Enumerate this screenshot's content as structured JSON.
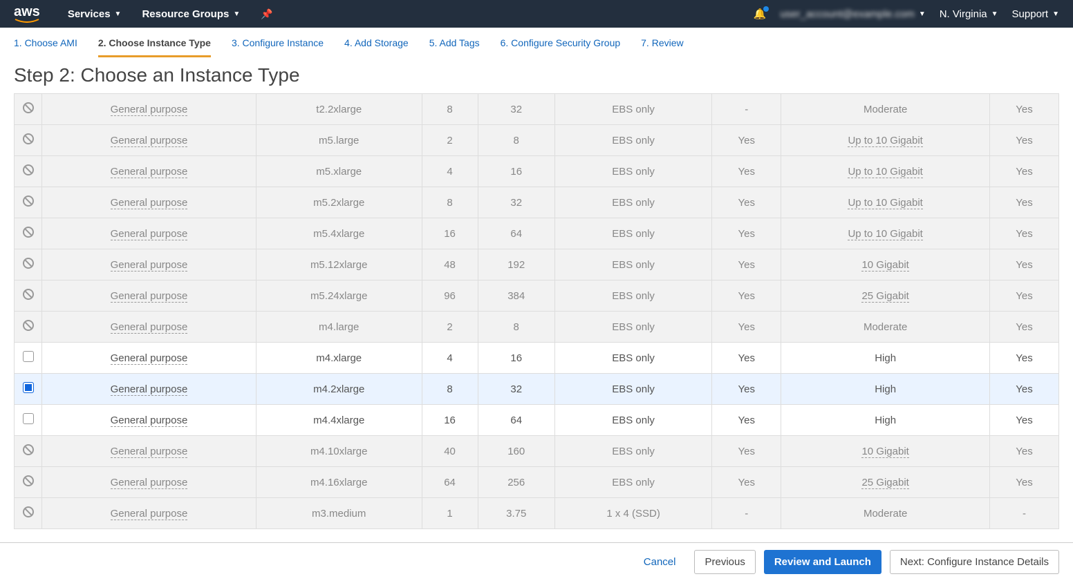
{
  "topnav": {
    "logo": "aws",
    "services": "Services",
    "resource_groups": "Resource Groups",
    "account_blur": "user_account@example.com",
    "region": "N. Virginia",
    "support": "Support"
  },
  "steps": {
    "s1": "1. Choose AMI",
    "s2": "2. Choose Instance Type",
    "s3": "3. Configure Instance",
    "s4": "4. Add Storage",
    "s5": "5. Add Tags",
    "s6": "6. Configure Security Group",
    "s7": "7. Review"
  },
  "page_title": "Step 2: Choose an Instance Type",
  "rows": [
    {
      "sel": "ban",
      "family": "General purpose",
      "type": "t2.2xlarge",
      "vcpu": "8",
      "mem": "32",
      "storage": "EBS only",
      "ebs": "-",
      "net": "Moderate",
      "ipv6": "Yes",
      "net_dash": false
    },
    {
      "sel": "ban",
      "family": "General purpose",
      "type": "m5.large",
      "vcpu": "2",
      "mem": "8",
      "storage": "EBS only",
      "ebs": "Yes",
      "net": "Up to 10 Gigabit",
      "ipv6": "Yes",
      "net_dash": true
    },
    {
      "sel": "ban",
      "family": "General purpose",
      "type": "m5.xlarge",
      "vcpu": "4",
      "mem": "16",
      "storage": "EBS only",
      "ebs": "Yes",
      "net": "Up to 10 Gigabit",
      "ipv6": "Yes",
      "net_dash": true
    },
    {
      "sel": "ban",
      "family": "General purpose",
      "type": "m5.2xlarge",
      "vcpu": "8",
      "mem": "32",
      "storage": "EBS only",
      "ebs": "Yes",
      "net": "Up to 10 Gigabit",
      "ipv6": "Yes",
      "net_dash": true
    },
    {
      "sel": "ban",
      "family": "General purpose",
      "type": "m5.4xlarge",
      "vcpu": "16",
      "mem": "64",
      "storage": "EBS only",
      "ebs": "Yes",
      "net": "Up to 10 Gigabit",
      "ipv6": "Yes",
      "net_dash": true
    },
    {
      "sel": "ban",
      "family": "General purpose",
      "type": "m5.12xlarge",
      "vcpu": "48",
      "mem": "192",
      "storage": "EBS only",
      "ebs": "Yes",
      "net": "10 Gigabit",
      "ipv6": "Yes",
      "net_dash": true
    },
    {
      "sel": "ban",
      "family": "General purpose",
      "type": "m5.24xlarge",
      "vcpu": "96",
      "mem": "384",
      "storage": "EBS only",
      "ebs": "Yes",
      "net": "25 Gigabit",
      "ipv6": "Yes",
      "net_dash": true
    },
    {
      "sel": "ban",
      "family": "General purpose",
      "type": "m4.large",
      "vcpu": "2",
      "mem": "8",
      "storage": "EBS only",
      "ebs": "Yes",
      "net": "Moderate",
      "ipv6": "Yes",
      "net_dash": false
    },
    {
      "sel": "unchecked",
      "family": "General purpose",
      "type": "m4.xlarge",
      "vcpu": "4",
      "mem": "16",
      "storage": "EBS only",
      "ebs": "Yes",
      "net": "High",
      "ipv6": "Yes",
      "net_dash": false
    },
    {
      "sel": "checked",
      "family": "General purpose",
      "type": "m4.2xlarge",
      "vcpu": "8",
      "mem": "32",
      "storage": "EBS only",
      "ebs": "Yes",
      "net": "High",
      "ipv6": "Yes",
      "net_dash": false
    },
    {
      "sel": "unchecked",
      "family": "General purpose",
      "type": "m4.4xlarge",
      "vcpu": "16",
      "mem": "64",
      "storage": "EBS only",
      "ebs": "Yes",
      "net": "High",
      "ipv6": "Yes",
      "net_dash": false
    },
    {
      "sel": "ban",
      "family": "General purpose",
      "type": "m4.10xlarge",
      "vcpu": "40",
      "mem": "160",
      "storage": "EBS only",
      "ebs": "Yes",
      "net": "10 Gigabit",
      "ipv6": "Yes",
      "net_dash": true
    },
    {
      "sel": "ban",
      "family": "General purpose",
      "type": "m4.16xlarge",
      "vcpu": "64",
      "mem": "256",
      "storage": "EBS only",
      "ebs": "Yes",
      "net": "25 Gigabit",
      "ipv6": "Yes",
      "net_dash": true
    },
    {
      "sel": "ban",
      "family": "General purpose",
      "type": "m3.medium",
      "vcpu": "1",
      "mem": "3.75",
      "storage": "1 x 4 (SSD)",
      "ebs": "-",
      "net": "Moderate",
      "ipv6": "-",
      "net_dash": false
    }
  ],
  "footer": {
    "cancel": "Cancel",
    "previous": "Previous",
    "review": "Review and Launch",
    "next": "Next: Configure Instance Details"
  }
}
